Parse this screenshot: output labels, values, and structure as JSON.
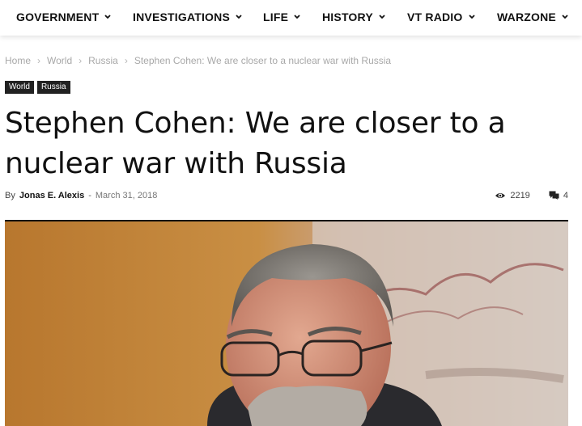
{
  "nav": {
    "items": [
      {
        "label": "GOVERNMENT"
      },
      {
        "label": "INVESTIGATIONS"
      },
      {
        "label": "LIFE"
      },
      {
        "label": "HISTORY"
      },
      {
        "label": "VT RADIO"
      },
      {
        "label": "WARZONE"
      }
    ]
  },
  "breadcrumb": {
    "home": "Home",
    "world": "World",
    "russia": "Russia",
    "current": "Stephen Cohen: We are closer to a nuclear war with Russia"
  },
  "categories": [
    "World",
    "Russia"
  ],
  "article": {
    "title": "Stephen Cohen: We are closer to a nuclear war with Russia",
    "by": "By",
    "author": "Jonas E. Alexis",
    "date": "March 31, 2018",
    "views": "2219",
    "comments": "4"
  },
  "icons": {
    "nav_dropdown": "chevron-down-icon",
    "views": "eye-icon",
    "comments": "comments-icon"
  },
  "colors": {
    "text": "#111111",
    "breadcrumb": "#a8a8a8",
    "category_bg": "#222222",
    "category_text": "#ffffff"
  }
}
